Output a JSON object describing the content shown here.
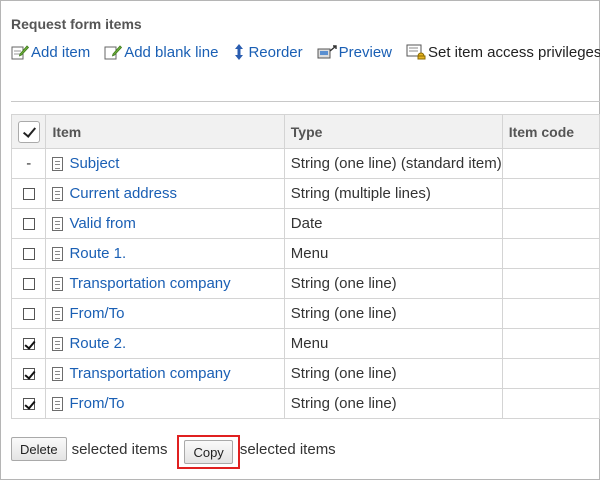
{
  "section": {
    "title": "Request form items"
  },
  "toolbar": {
    "add_item": "Add item",
    "add_blank_line": "Add blank line",
    "reorder": "Reorder",
    "preview": "Preview",
    "access": "Set item access privileges"
  },
  "table": {
    "headers": {
      "item": "Item",
      "type": "Type",
      "code": "Item code"
    },
    "rows": [
      {
        "select": "-",
        "name": "Subject",
        "type": "String (one line) (standard item)",
        "code": ""
      },
      {
        "select": "unchecked",
        "name": "Current address",
        "type": "String (multiple lines)",
        "code": ""
      },
      {
        "select": "unchecked",
        "name": "Valid from",
        "type": "Date",
        "code": ""
      },
      {
        "select": "unchecked",
        "name": "Route 1.",
        "type": "Menu",
        "code": ""
      },
      {
        "select": "unchecked",
        "name": "Transportation company",
        "type": "String (one line)",
        "code": ""
      },
      {
        "select": "unchecked",
        "name": "From/To",
        "type": "String (one line)",
        "code": ""
      },
      {
        "select": "checked",
        "name": "Route 2.",
        "type": "Menu",
        "code": ""
      },
      {
        "select": "checked",
        "name": "Transportation company",
        "type": "String (one line)",
        "code": ""
      },
      {
        "select": "checked",
        "name": "From/To",
        "type": "String (one line)",
        "code": ""
      }
    ]
  },
  "footer": {
    "delete_label": "Delete",
    "delete_suffix": "selected items",
    "copy_label": "Copy",
    "copy_suffix": "selected items"
  },
  "colors": {
    "link": "#1a5fb4",
    "highlight": "#e02020",
    "header_bg": "#f1f1f1"
  },
  "icons": [
    "add-item-icon",
    "add-blank-line-icon",
    "reorder-icon",
    "preview-icon",
    "access-privileges-icon",
    "document-icon",
    "checkbox-checked-icon"
  ]
}
